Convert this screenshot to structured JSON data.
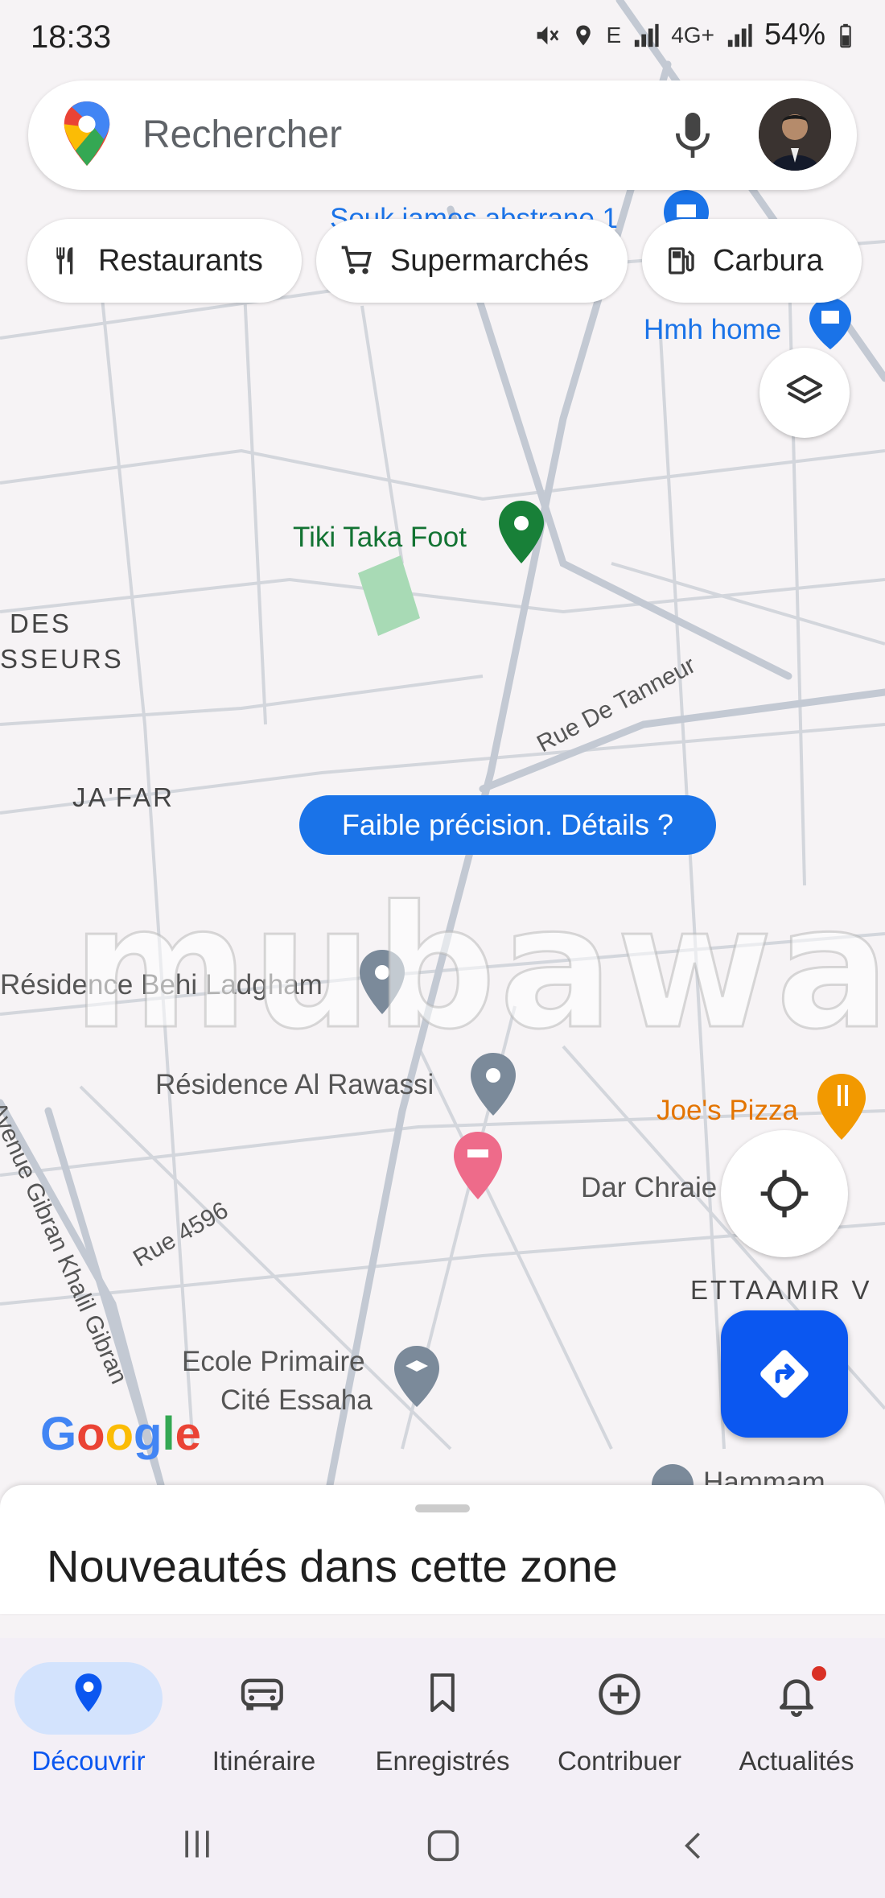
{
  "status_bar": {
    "time": "18:33",
    "signal_e": "E",
    "network_type": "4G+",
    "battery": "54%"
  },
  "search": {
    "placeholder": "Rechercher"
  },
  "chips": [
    {
      "label": "Restaurants",
      "icon": "restaurant-icon"
    },
    {
      "label": "Supermarchés",
      "icon": "cart-icon"
    },
    {
      "label": "Carbura",
      "icon": "fuel-icon"
    }
  ],
  "map_labels": {
    "top_cut": "Souk james abstrane 1",
    "hmh_home": "Hmh home",
    "tiki_taka": "Tiki Taka Foot",
    "des": "DES",
    "sseurs": "SSEURS",
    "jafar": "JA'FAR",
    "rue_tanneur": "Rue De Tanneur",
    "residence_behi": "Résidence Behi Ladgham",
    "residence_rawassi": "Résidence Al Rawassi",
    "joes_pizza": "Joe's Pizza",
    "dar_chraie": "Dar Chraie",
    "ettaamir": "ETTAAMIR V",
    "avenue_gibran": "Avenue Gibran Khalil Gibran",
    "rue_4596": "Rue 4596",
    "ecole_line1": "Ecole Primaire",
    "ecole_line2": "Cité Essaha",
    "hammam": "Hammam"
  },
  "accuracy_chip": "Faible précision. Détails ?",
  "watermark": "mubawab",
  "google_logo": "Google",
  "sheet": {
    "title": "Nouveautés dans cette zone"
  },
  "bottom_nav": [
    {
      "label": "Découvrir",
      "active": true
    },
    {
      "label": "Itinéraire",
      "active": false
    },
    {
      "label": "Enregistrés",
      "active": false
    },
    {
      "label": "Contribuer",
      "active": false
    },
    {
      "label": "Actualités",
      "active": false,
      "badge": true
    }
  ],
  "colors": {
    "accent": "#0b57f0",
    "link": "#1a73e8",
    "park": "#a8dab5",
    "poi_green": "#188038",
    "poi_orange": "#f29900",
    "hotel_pink": "#ee6b8a",
    "badge_red": "#d93025"
  }
}
